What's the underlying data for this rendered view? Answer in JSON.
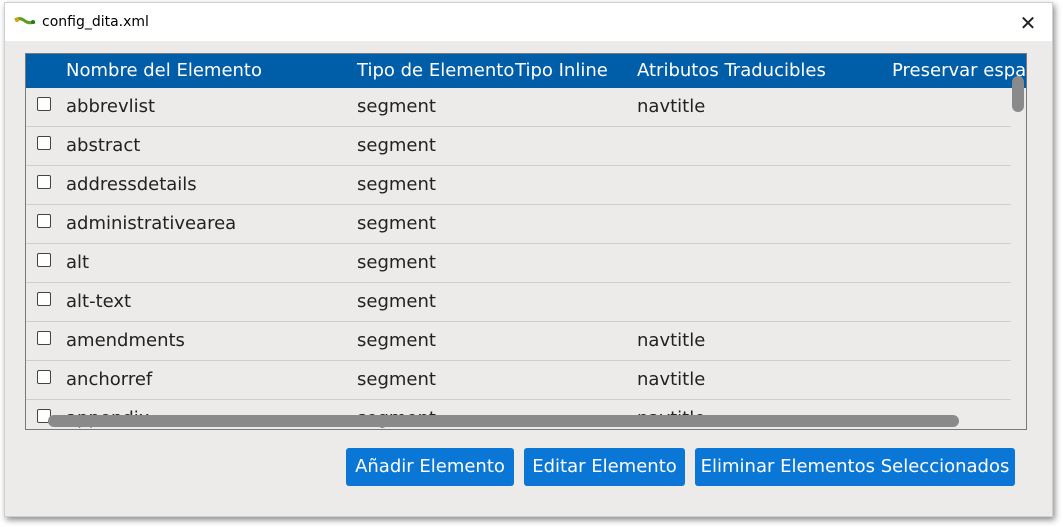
{
  "window": {
    "title": "config_dita.xml",
    "close_symbol": "✕"
  },
  "table": {
    "columns": [
      "Nombre del Elemento",
      "Tipo de Elemento",
      "Tipo Inline",
      "Atributos Traducibles",
      "Preservar espa"
    ],
    "rows": [
      {
        "name": "abbrevlist",
        "type": "segment",
        "inline": "",
        "attrs": "navtitle"
      },
      {
        "name": "abstract",
        "type": "segment",
        "inline": "",
        "attrs": ""
      },
      {
        "name": "addressdetails",
        "type": "segment",
        "inline": "",
        "attrs": ""
      },
      {
        "name": "administrativearea",
        "type": "segment",
        "inline": "",
        "attrs": ""
      },
      {
        "name": "alt",
        "type": "segment",
        "inline": "",
        "attrs": ""
      },
      {
        "name": "alt-text",
        "type": "segment",
        "inline": "",
        "attrs": ""
      },
      {
        "name": "amendments",
        "type": "segment",
        "inline": "",
        "attrs": "navtitle"
      },
      {
        "name": "anchorref",
        "type": "segment",
        "inline": "",
        "attrs": "navtitle"
      },
      {
        "name": "appendix",
        "type": "segment",
        "inline": "",
        "attrs": "navtitle"
      }
    ]
  },
  "buttons": {
    "add": "Añadir Elemento",
    "edit": "Editar Elemento",
    "delete": "Eliminar Elementos Seleccionados"
  },
  "colors": {
    "header": "#005da8",
    "button": "#0a77d6",
    "background": "#ecebe9"
  }
}
